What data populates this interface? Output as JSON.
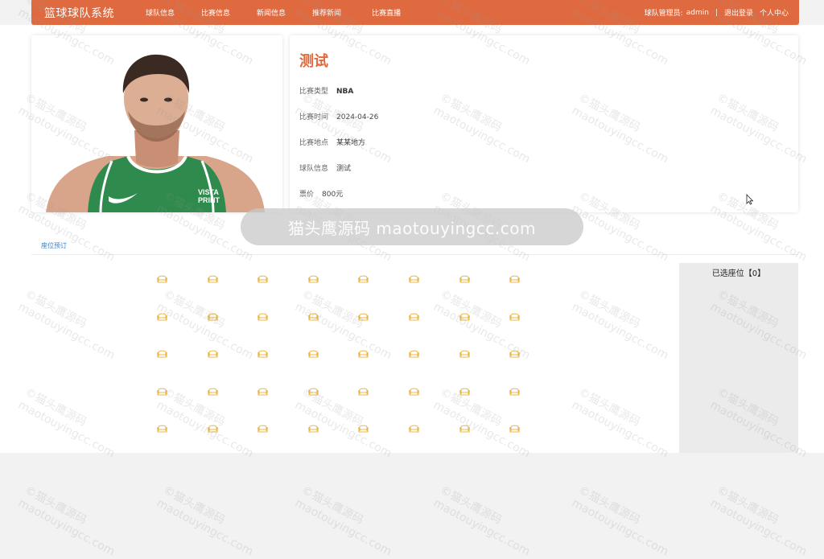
{
  "header": {
    "brand": "篮球球队系统",
    "nav": [
      "球队信息",
      "比赛信息",
      "新闻信息",
      "推荐新闻",
      "比赛直播"
    ],
    "user_label": "球队管理员:",
    "user_name": "admin",
    "separator": "|",
    "logout": "退出登录",
    "profile": "个人中心"
  },
  "match": {
    "title": "测试",
    "type_label": "比赛类型",
    "type_value": "NBA",
    "time_label": "比赛时间",
    "time_value": "2024-04-26",
    "place_label": "比赛地点",
    "place_value": "某某地方",
    "team_label": "球队信息",
    "team_value": "测试",
    "price_label": "票价",
    "price_value": "800元"
  },
  "jersey_text": [
    "VISTA",
    "PRINT"
  ],
  "tab": {
    "label": "座位预订"
  },
  "seat_map": {
    "rows": 5,
    "cols": 8
  },
  "side": {
    "title": "已选座位【0】"
  },
  "toast": "猫头鹰源码 maotouyingcc.com",
  "watermark": {
    "line1": "©猫头鹰源码",
    "line2": "maotouyingcc.com"
  },
  "colors": {
    "accent": "#e06a3f",
    "seat": "#e8b84a",
    "link": "#3a7fc4"
  }
}
